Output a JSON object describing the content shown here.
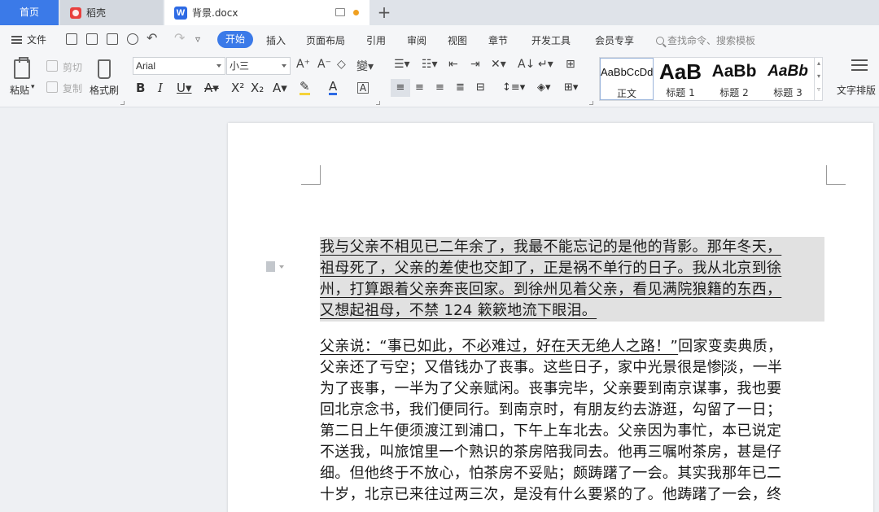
{
  "tabs": {
    "home": "首页",
    "daoke": "稻壳",
    "doc": "背景.docx",
    "doc_logo": "W"
  },
  "menubar": {
    "file": "文件",
    "items": [
      "开始",
      "插入",
      "页面布局",
      "引用",
      "审阅",
      "视图",
      "章节",
      "开发工具",
      "会员专享"
    ],
    "search_placeholder": "查找命令、搜索模板"
  },
  "ribbon": {
    "paste": "粘贴",
    "cut": "剪切",
    "copy": "复制",
    "format_painter": "格式刷",
    "font_name": "Arial",
    "font_size": "小三",
    "styles": [
      {
        "sample": "AaBbCcDd",
        "name": "正文"
      },
      {
        "sample": "AaB",
        "name": "标题 1"
      },
      {
        "sample": "AaBb",
        "name": "标题 2"
      },
      {
        "sample": "AaBb",
        "name": "标题 3"
      }
    ],
    "text_layout": "文字排版"
  },
  "document": {
    "para1_lines": [
      "我与父亲不相见已二年余了，我最不能忘记的是他的背影。那年冬天，",
      "祖母死了，父亲的差使也交卸了，正是祸不单行的日子。我从北京到徐",
      "州，打算跟着父亲奔丧回家。到徐州见着父亲，看见满院狼籍的东西，",
      "又想起祖母，不禁 124 簌簌地流下眼泪。"
    ],
    "para2_line1_ul": "父亲说：“事已如此，不必难过，好在天无绝人之路！”",
    "para2_line1_rest": "回家变卖典质，",
    "para2_line2_a": "父亲还了亏空；又借钱办了丧事。这些日子，家中光景很是惨",
    "para2_line2_b": "淡，一半",
    "para2_lines": [
      "为了丧事，一半为了父亲赋闲。丧事完毕，父亲要到南京谋事，我也要",
      "回北京念书，我们便同行。到南京时，有朋友约去游逛，勾留了一日；",
      "第二日上午便须渡江到浦口，下午上车北去。父亲因为事忙，本已说定",
      "不送我，叫旅馆里一个熟识的茶房陪我同去。他再三嘱咐茶房，甚是仔",
      "细。但他终于不放心，怕茶房不妥贴；颇踌躇了一会。其实我那年已二",
      "十岁，北京已来往过两三次，是没有什么要紧的了。他踌躇了一会，终"
    ]
  }
}
